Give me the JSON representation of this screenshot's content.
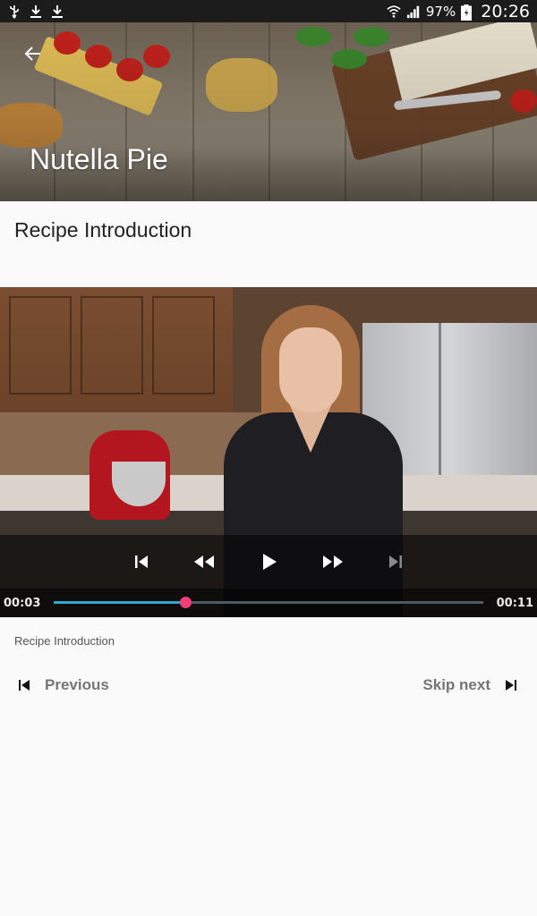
{
  "status_bar": {
    "battery_percent": "97%",
    "time": "20:26",
    "icons": [
      "usb-icon",
      "download-icon",
      "download-icon",
      "wifi-icon",
      "signal-icon",
      "battery-icon"
    ]
  },
  "header": {
    "title": "Nutella Pie",
    "back_icon": "arrow-left-icon"
  },
  "step": {
    "title": "Recipe Introduction",
    "description": "Recipe Introduction"
  },
  "video_player": {
    "current_time": "00:03",
    "duration": "00:11",
    "progress": 0.306,
    "accent_color": "#32a6d3",
    "thumb_color": "#ee3f79",
    "controls": [
      "skip-previous-icon",
      "rewind-icon",
      "play-icon",
      "fast-forward-icon",
      "skip-next-icon"
    ]
  },
  "navigation": {
    "previous_label": "Previous",
    "next_label": "Skip next"
  }
}
